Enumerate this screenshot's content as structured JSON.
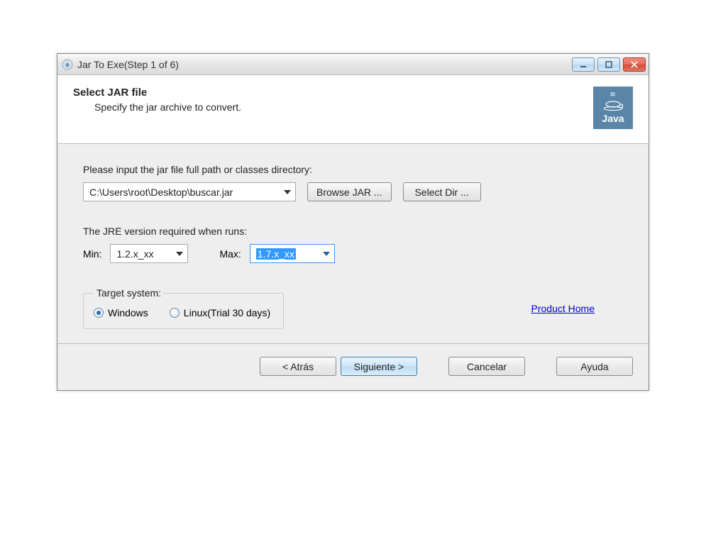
{
  "window": {
    "title": "Jar To Exe(Step 1 of 6)"
  },
  "header": {
    "title": "Select JAR file",
    "subtitle": "Specify the jar archive to convert.",
    "logo_text": "Java"
  },
  "content": {
    "path_label": "Please input the jar file full path or classes directory:",
    "path_value": "C:\\Users\\root\\Desktop\\buscar.jar",
    "browse_label": "Browse JAR ...",
    "select_dir_label": "Select Dir ...",
    "jre_label": "The JRE version required when runs:",
    "min_label": "Min:",
    "min_value": "1.2.x_xx",
    "max_label": "Max:",
    "max_value": "1.7.x_xx",
    "target_legend": "Target system:",
    "radio_windows": "Windows",
    "radio_linux": "Linux(Trial 30 days)",
    "product_home": "Product Home"
  },
  "footer": {
    "back": "< Atrás",
    "next": "Siguiente >",
    "cancel": "Cancelar",
    "help": "Ayuda"
  }
}
